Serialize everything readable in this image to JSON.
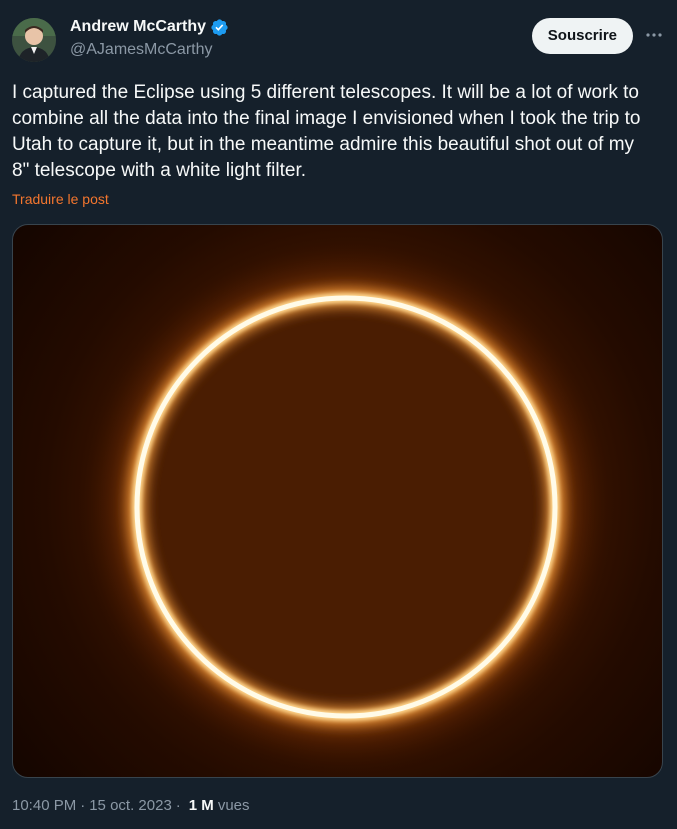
{
  "author": {
    "name": "Andrew McCarthy",
    "handle": "@AJamesMcCarthy",
    "verified": true
  },
  "actions": {
    "subscribe_label": "Souscrire"
  },
  "tweet": {
    "text": "I captured the Eclipse using 5 different telescopes. It will be a lot of work to combine all the data into the final image I envisioned when I took the trip to Utah to capture it, but in the meantime admire this beautiful shot out of my 8\" telescope with a white light filter.",
    "translate_label": "Traduire le post"
  },
  "meta": {
    "time": "10:40 PM",
    "separator": "·",
    "date": "15 oct. 2023",
    "views_count": "1 M",
    "views_label": "vues"
  },
  "colors": {
    "background": "#15202b",
    "accent": "#f4762e",
    "verified": "#1d9bf0",
    "secondary_text": "#8b98a5"
  },
  "icons": {
    "verified": "verified-badge-icon",
    "more": "more-horizontal-icon"
  }
}
